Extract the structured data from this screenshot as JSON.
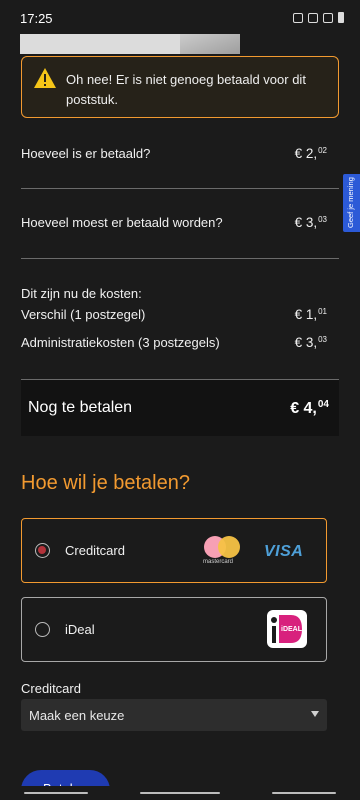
{
  "status_bar": {
    "time": "17:25"
  },
  "alert": {
    "message": "Oh nee! Er is niet genoeg betaald voor dit poststuk.",
    "color": "#f29a30"
  },
  "paid": {
    "label": "Hoeveel is er betaald?",
    "euros": "€ 2,",
    "cents": "02"
  },
  "due": {
    "label": "Hoeveel moest er betaald worden?",
    "euros": "€ 3,",
    "cents": "03"
  },
  "costs": {
    "heading": "Dit zijn nu de kosten:",
    "difference": {
      "label": "Verschil (1 postzegel)",
      "euros": "€ 1,",
      "cents": "01"
    },
    "admin": {
      "label": "Administratiekosten (3 postzegels)",
      "euros": "€ 3,",
      "cents": "03"
    }
  },
  "total": {
    "label": "Nog te betalen",
    "euros": "€ 4,",
    "cents": "04"
  },
  "feedback_tab": "Geef je mening",
  "payment": {
    "title": "Hoe wil je betalen?",
    "options": [
      {
        "label": "Creditcard",
        "selected": true,
        "icons": [
          "mastercard-logo",
          "visa-logo"
        ]
      },
      {
        "label": "iDeal",
        "selected": false,
        "icons": [
          "ideal-logo"
        ]
      }
    ],
    "mastercard_text": "mastercard",
    "visa_text": "VISA",
    "ideal_text": "iDEAL"
  },
  "creditcard_select": {
    "label": "Creditcard",
    "value": "Maak een keuze"
  },
  "pay_button": "Betalen",
  "colors": {
    "accent": "#f29a30",
    "primary": "#1f3bb2",
    "background": "#1b1b1b"
  }
}
